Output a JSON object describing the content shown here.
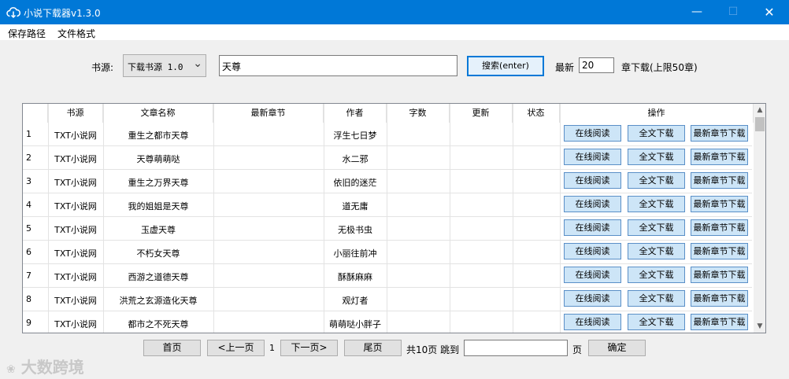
{
  "window": {
    "title": "小说下载器v1.3.0",
    "minimize_glyph": "—",
    "maximize_glyph": "☐",
    "close_glyph": "✕"
  },
  "menu": {
    "items": [
      {
        "label": "保存路径"
      },
      {
        "label": "文件格式"
      }
    ]
  },
  "search": {
    "source_label": "书源:",
    "source_value": "下载书源 1.0",
    "query": "天尊",
    "search_button": "搜索(enter)",
    "latest_label": "最新",
    "latest_value": "20",
    "latest_suffix": "章下载(上限50章)"
  },
  "table": {
    "columns": [
      "书源",
      "文章名称",
      "最新章节",
      "作者",
      "字数",
      "更新",
      "状态",
      "操作"
    ],
    "action_labels": {
      "read": "在线阅读",
      "download_all": "全文下载",
      "download_latest": "最新章节下载"
    },
    "rows": [
      {
        "index": "1",
        "source": "TXT小说网",
        "name": "重生之都市天尊",
        "latest": "",
        "author": "浮生七日梦",
        "words": "",
        "updated": "",
        "status": ""
      },
      {
        "index": "2",
        "source": "TXT小说网",
        "name": "天尊萌萌哒",
        "latest": "",
        "author": "水二邪",
        "words": "",
        "updated": "",
        "status": ""
      },
      {
        "index": "3",
        "source": "TXT小说网",
        "name": "重生之万界天尊",
        "latest": "",
        "author": "依旧的迷茫",
        "words": "",
        "updated": "",
        "status": ""
      },
      {
        "index": "4",
        "source": "TXT小说网",
        "name": "我的姐姐是天尊",
        "latest": "",
        "author": "道无庸",
        "words": "",
        "updated": "",
        "status": ""
      },
      {
        "index": "5",
        "source": "TXT小说网",
        "name": "玉虚天尊",
        "latest": "",
        "author": "无极书虫",
        "words": "",
        "updated": "",
        "status": ""
      },
      {
        "index": "6",
        "source": "TXT小说网",
        "name": "不朽女天尊",
        "latest": "",
        "author": "小丽往前冲",
        "words": "",
        "updated": "",
        "status": ""
      },
      {
        "index": "7",
        "source": "TXT小说网",
        "name": "西游之道德天尊",
        "latest": "",
        "author": "酥酥麻麻",
        "words": "",
        "updated": "",
        "status": ""
      },
      {
        "index": "8",
        "source": "TXT小说网",
        "name": "洪荒之玄源造化天尊",
        "latest": "",
        "author": "观灯者",
        "words": "",
        "updated": "",
        "status": ""
      },
      {
        "index": "9",
        "source": "TXT小说网",
        "name": "都市之不死天尊",
        "latest": "",
        "author": "萌萌哒小胖子",
        "words": "",
        "updated": "",
        "status": ""
      }
    ]
  },
  "pager": {
    "first": "首页",
    "prev": "<上一页",
    "current": "1",
    "next": "下一页>",
    "last": "尾页",
    "total_jump": "共10页 跳到",
    "page_input": "",
    "page_suffix": "页",
    "confirm": "确定"
  },
  "watermark": {
    "text": "大数跨境"
  }
}
